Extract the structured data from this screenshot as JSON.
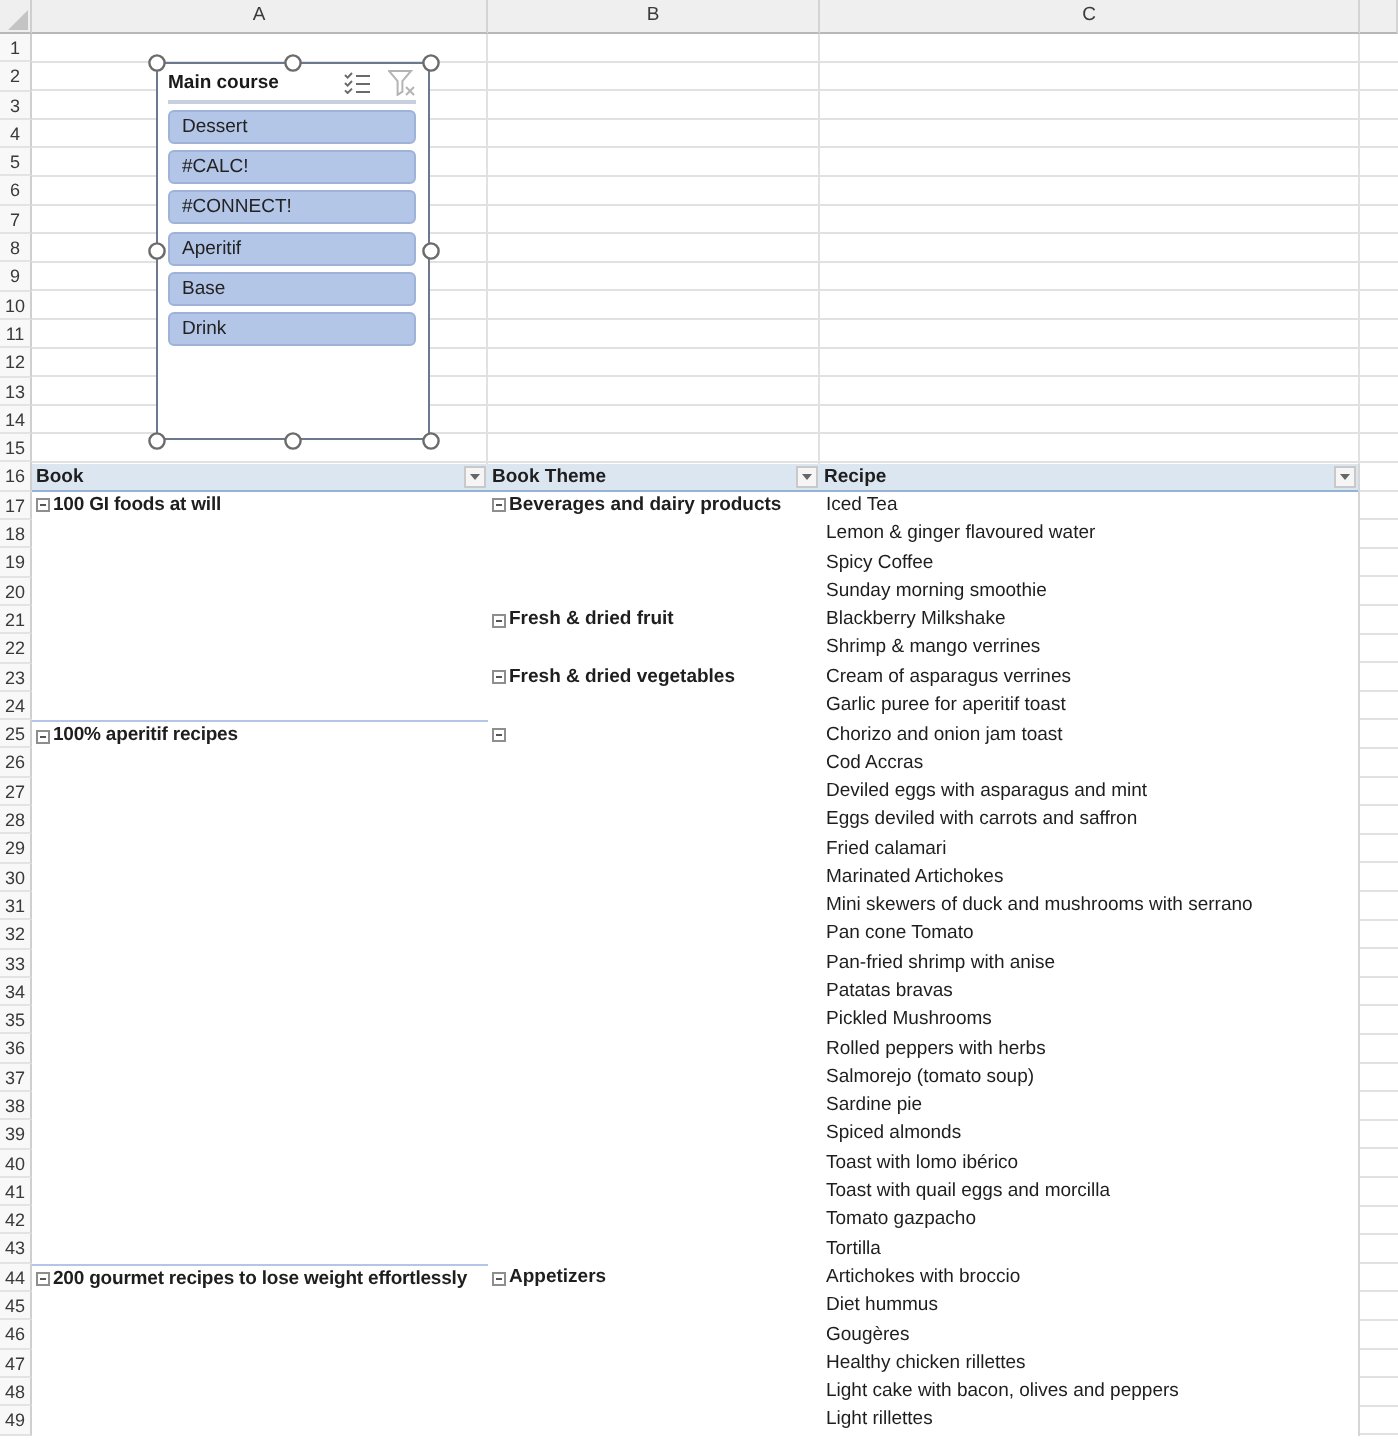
{
  "sheet": {
    "columns": [
      "A",
      "B",
      "C"
    ],
    "row_numbers": [
      "1",
      "2",
      "3",
      "4",
      "5",
      "6",
      "7",
      "8",
      "9",
      "10",
      "11",
      "12",
      "13",
      "14",
      "15",
      "16",
      "17",
      "18",
      "19",
      "20",
      "21",
      "22",
      "23",
      "24",
      "25",
      "26",
      "27",
      "28",
      "29",
      "30",
      "31",
      "32",
      "33",
      "34",
      "35",
      "36",
      "37",
      "38",
      "39",
      "40",
      "41",
      "42",
      "43",
      "44",
      "45",
      "46",
      "47",
      "48",
      "49"
    ]
  },
  "slicer": {
    "title": "Main course",
    "selected": true,
    "multi_select": false,
    "clear_filter_disabled": true,
    "items": [
      {
        "label": "Dessert",
        "selected": true
      },
      {
        "label": "#CALC!",
        "selected": true
      },
      {
        "label": "#CONNECT!",
        "selected": true
      },
      {
        "label": "Aperitif",
        "selected": true
      },
      {
        "label": "Base",
        "selected": true
      },
      {
        "label": "Drink",
        "selected": true
      }
    ]
  },
  "pivot": {
    "headers": [
      "Book",
      "Book Theme",
      "Recipe"
    ],
    "books": [
      {
        "label": "100 GI foods at will",
        "expanded": true,
        "children": [
          {
            "label": "Beverages and dairy products",
            "expanded": true,
            "children": [
              "Iced Tea",
              "Lemon & ginger flavoured water",
              "Spicy Coffee",
              "Sunday morning smoothie"
            ]
          },
          {
            "label": "Fresh & dried fruit",
            "expanded": true,
            "children": [
              "Blackberry Milkshake",
              "Shrimp & mango verrines"
            ]
          },
          {
            "label": "Fresh & dried vegetables",
            "expanded": true,
            "children": [
              "Cream of asparagus verrines",
              "Garlic puree for aperitif toast"
            ]
          }
        ]
      },
      {
        "label": "100% aperitif recipes",
        "expanded": true,
        "children": [
          {
            "expanded": true,
            "children": [
              "Chorizo and onion jam toast",
              "Cod Accras",
              "Deviled eggs with asparagus and mint",
              "Eggs deviled with carrots and saffron",
              "Fried calamari",
              "Marinated Artichokes",
              "Mini skewers of duck and mushrooms with serrano",
              "Pan cone Tomato",
              "Pan-fried shrimp with anise",
              "Patatas bravas",
              "Pickled Mushrooms",
              "Rolled peppers with herbs",
              "Salmorejo (tomato soup)",
              "Sardine pie",
              "Spiced almonds",
              "Toast with lomo ibérico",
              "Toast with quail eggs and morcilla",
              "Tomato gazpacho",
              "Tortilla"
            ]
          }
        ]
      },
      {
        "label": "200 gourmet recipes to lose weight effortlessly",
        "expanded": true,
        "children": [
          {
            "label": "Appetizers",
            "expanded": true,
            "children": [
              "Artichokes with broccio",
              "Diet hummus",
              "Gougères",
              "Healthy chicken rillettes",
              "Light cake with bacon, olives and peppers",
              "Light rillettes"
            ]
          }
        ]
      }
    ]
  }
}
